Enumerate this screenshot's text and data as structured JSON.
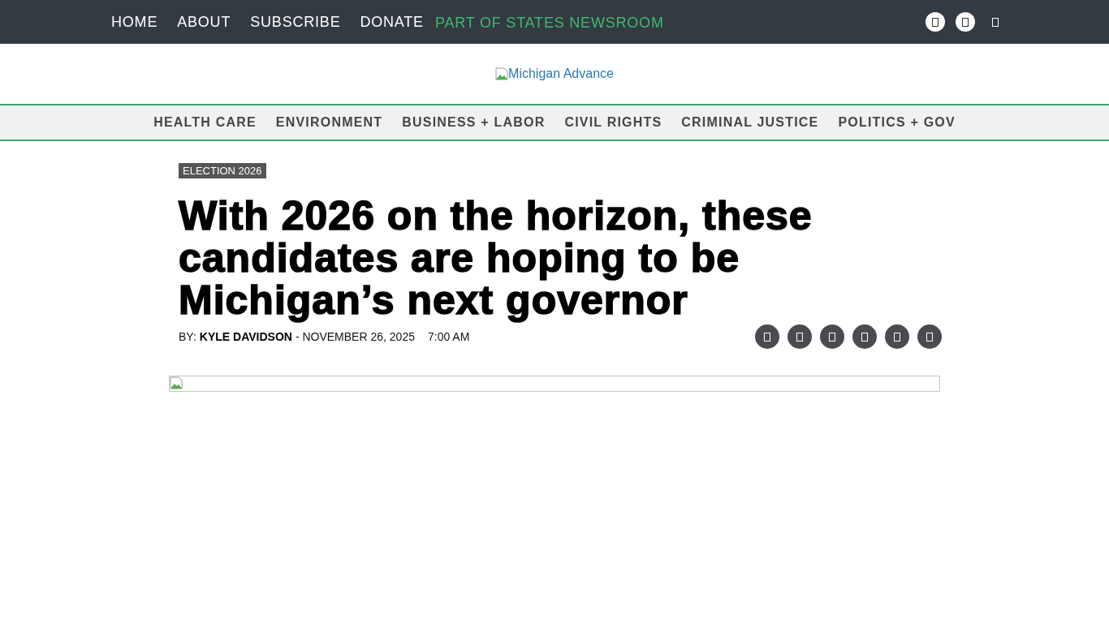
{
  "top_nav": {
    "items": [
      "HOME",
      "ABOUT",
      "SUBSCRIBE",
      "DONATE"
    ],
    "tagline": "PART OF STATES NEWSROOM"
  },
  "logo": {
    "alt": "Michigan Advance"
  },
  "category_nav": {
    "items": [
      "HEALTH CARE",
      "ENVIRONMENT",
      "BUSINESS + LABOR",
      "CIVIL RIGHTS",
      "CRIMINAL JUSTICE",
      "POLITICS + GOV"
    ]
  },
  "article": {
    "category": "ELECTION 2026",
    "headline": "With 2026 on the horizon, these candidates are hoping to be Michigan’s next governor",
    "byline": {
      "prefix": "BY:",
      "author": "KYLE DAVIDSON",
      "date": "- NOVEMBER 26, 2025",
      "time": "7:00 AM"
    }
  }
}
